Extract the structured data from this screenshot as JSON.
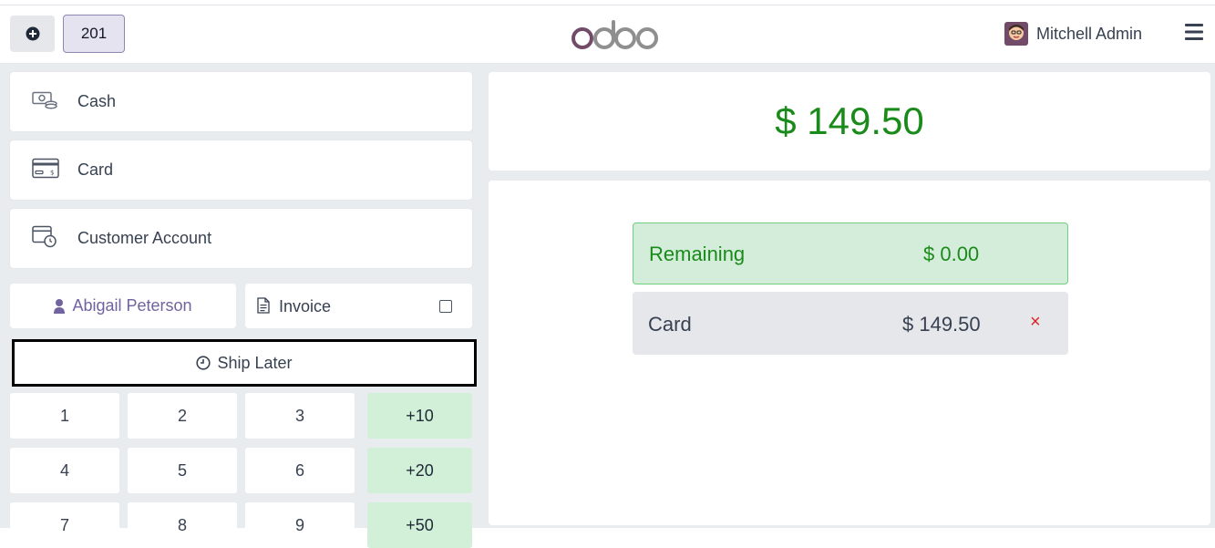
{
  "header": {
    "order_number": "201",
    "brand": "odoo",
    "user_name": "Mitchell Admin",
    "icons": {
      "new_order": "plus-circle-icon",
      "menu": "hamburger-menu-icon",
      "avatar": "user-avatar"
    }
  },
  "payment_methods": [
    {
      "label": "Cash",
      "icon": "cash-icon"
    },
    {
      "label": "Card",
      "icon": "card-icon"
    },
    {
      "label": "Customer Account",
      "icon": "customer-account-icon"
    }
  ],
  "customer": {
    "name": "Abigail Peterson",
    "icon": "user-icon"
  },
  "invoice": {
    "label": "Invoice",
    "checked": false,
    "icon": "document-icon"
  },
  "ship_later": {
    "label": "Ship Later",
    "icon": "clock-icon"
  },
  "numpad": {
    "keys": [
      "1",
      "2",
      "3",
      "+10",
      "4",
      "5",
      "6",
      "+20",
      "7",
      "8",
      "9",
      "+50"
    ]
  },
  "summary": {
    "total": "$ 149.50",
    "remaining_label": "Remaining",
    "remaining_value": "$ 0.00",
    "payment_lines": [
      {
        "method": "Card",
        "amount": "$ 149.50",
        "remove": "×"
      }
    ]
  },
  "colors": {
    "brand_purple": "#71639e",
    "total_green": "#1a8a1a",
    "remaining_bg": "#d4edda",
    "plus_key_bg": "#d1f0d7",
    "remove_red": "#dc2626"
  }
}
